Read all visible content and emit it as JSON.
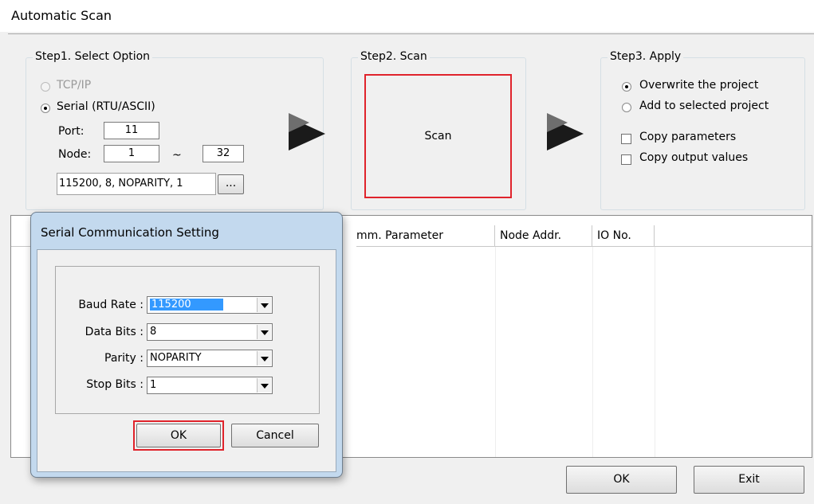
{
  "window": {
    "title": "Automatic Scan"
  },
  "step1": {
    "legend": "Step1. Select Option",
    "tcp_label": "TCP/IP",
    "serial_label": "Serial (RTU/ASCII)",
    "port_label": "Port:",
    "port_value": "11",
    "node_label": "Node:",
    "node_from": "1",
    "node_sep": "~",
    "node_to": "32",
    "serial_summary": "115200, 8, NOPARITY, 1",
    "browse_label": "..."
  },
  "step2": {
    "legend": "Step2. Scan",
    "scan_label": "Scan"
  },
  "step3": {
    "legend": "Step3. Apply",
    "overwrite_label": "Overwrite the project",
    "add_label": "Add to selected project",
    "copy_params_label": "Copy parameters",
    "copy_outputs_label": "Copy output values"
  },
  "table": {
    "columns": [
      "mm. Parameter",
      "Node Addr.",
      "IO No."
    ]
  },
  "footer": {
    "ok_label": "OK",
    "exit_label": "Exit"
  },
  "dialog": {
    "title": "Serial Communication Setting",
    "baud_label": "Baud Rate :",
    "baud_value": "115200",
    "databits_label": "Data Bits :",
    "databits_value": "8",
    "parity_label": "Parity :",
    "parity_value": "NOPARITY",
    "stopbits_label": "Stop Bits :",
    "stopbits_value": "1",
    "ok_label": "OK",
    "cancel_label": "Cancel"
  },
  "colors": {
    "highlight_red": "#e0232b",
    "selection_blue": "#3399ff",
    "dialog_frame": "#c3d9ee"
  }
}
